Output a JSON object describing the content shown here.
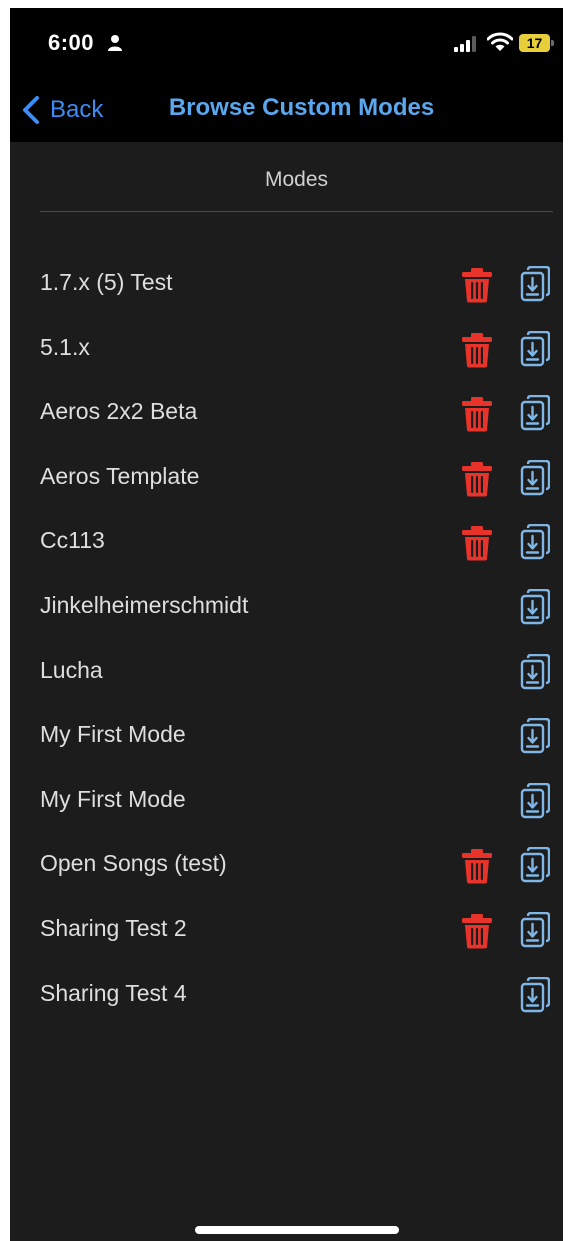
{
  "status_bar": {
    "time": "6:00",
    "battery": "17"
  },
  "nav": {
    "back_label": "Back",
    "title": "Browse Custom Modes"
  },
  "section": {
    "header": "Modes"
  },
  "modes": [
    {
      "name": "1.7.x (5) Test",
      "deletable": true
    },
    {
      "name": "5.1.x",
      "deletable": true
    },
    {
      "name": "Aeros 2x2 Beta",
      "deletable": true
    },
    {
      "name": "Aeros Template",
      "deletable": true
    },
    {
      "name": "Cc113",
      "deletable": true
    },
    {
      "name": "Jinkelheimerschmidt",
      "deletable": false
    },
    {
      "name": "Lucha",
      "deletable": false
    },
    {
      "name": "My First Mode",
      "deletable": false
    },
    {
      "name": "My First Mode",
      "deletable": false
    },
    {
      "name": "Open Songs (test)",
      "deletable": true
    },
    {
      "name": "Sharing Test 2",
      "deletable": true
    },
    {
      "name": "Sharing Test 4",
      "deletable": false
    }
  ],
  "icons": {
    "delete": "trash-icon",
    "import": "import-icon"
  },
  "colors": {
    "accent": "#3b8cf5",
    "delete": "#e8332b",
    "import": "#7fb6e6"
  }
}
